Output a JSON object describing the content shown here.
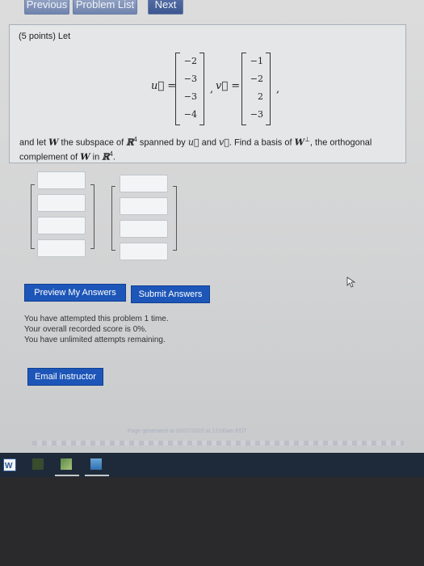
{
  "nav": {
    "previous": "Previous",
    "problem_list": "Problem List",
    "next": "Next"
  },
  "problem": {
    "points": "(5 points) Let",
    "u_label": "u⃗ =",
    "u": [
      "−2",
      "−3",
      "−3",
      "−4"
    ],
    "comma_sep": ",",
    "v_label": "v⃗ =",
    "v": [
      "−1",
      "−2",
      "2",
      "−3"
    ],
    "trailing": ",",
    "statement_1": "and let",
    "W": "W",
    "statement_2": "the subspace of",
    "R": "ℝ",
    "exp4": "4",
    "statement_3": "spanned by",
    "u_sym": "u⃗",
    "and": "and",
    "v_sym": "v⃗",
    "statement_4": ". Find a basis of",
    "Wperp": "W",
    "perp": "⊥",
    "statement_5": ", the orthogonal",
    "statement_6": "complement of",
    "W2": "W",
    "in": "in",
    "R2": "ℝ",
    "exp4b": "4",
    "period": "."
  },
  "buttons": {
    "preview": "Preview My Answers",
    "submit": "Submit Answers",
    "email": "Email instructor"
  },
  "status": {
    "attempted": "You have attempted this problem 1 time.",
    "score": "Your overall recorded score is 0%.",
    "remaining": "You have unlimited attempts remaining."
  },
  "footer": {
    "generated": "Page generated at 05/07/2020 at 12:00am EDT"
  },
  "colors": {
    "accent": "#1d56b8",
    "taskbar": "#1e2a3a"
  }
}
